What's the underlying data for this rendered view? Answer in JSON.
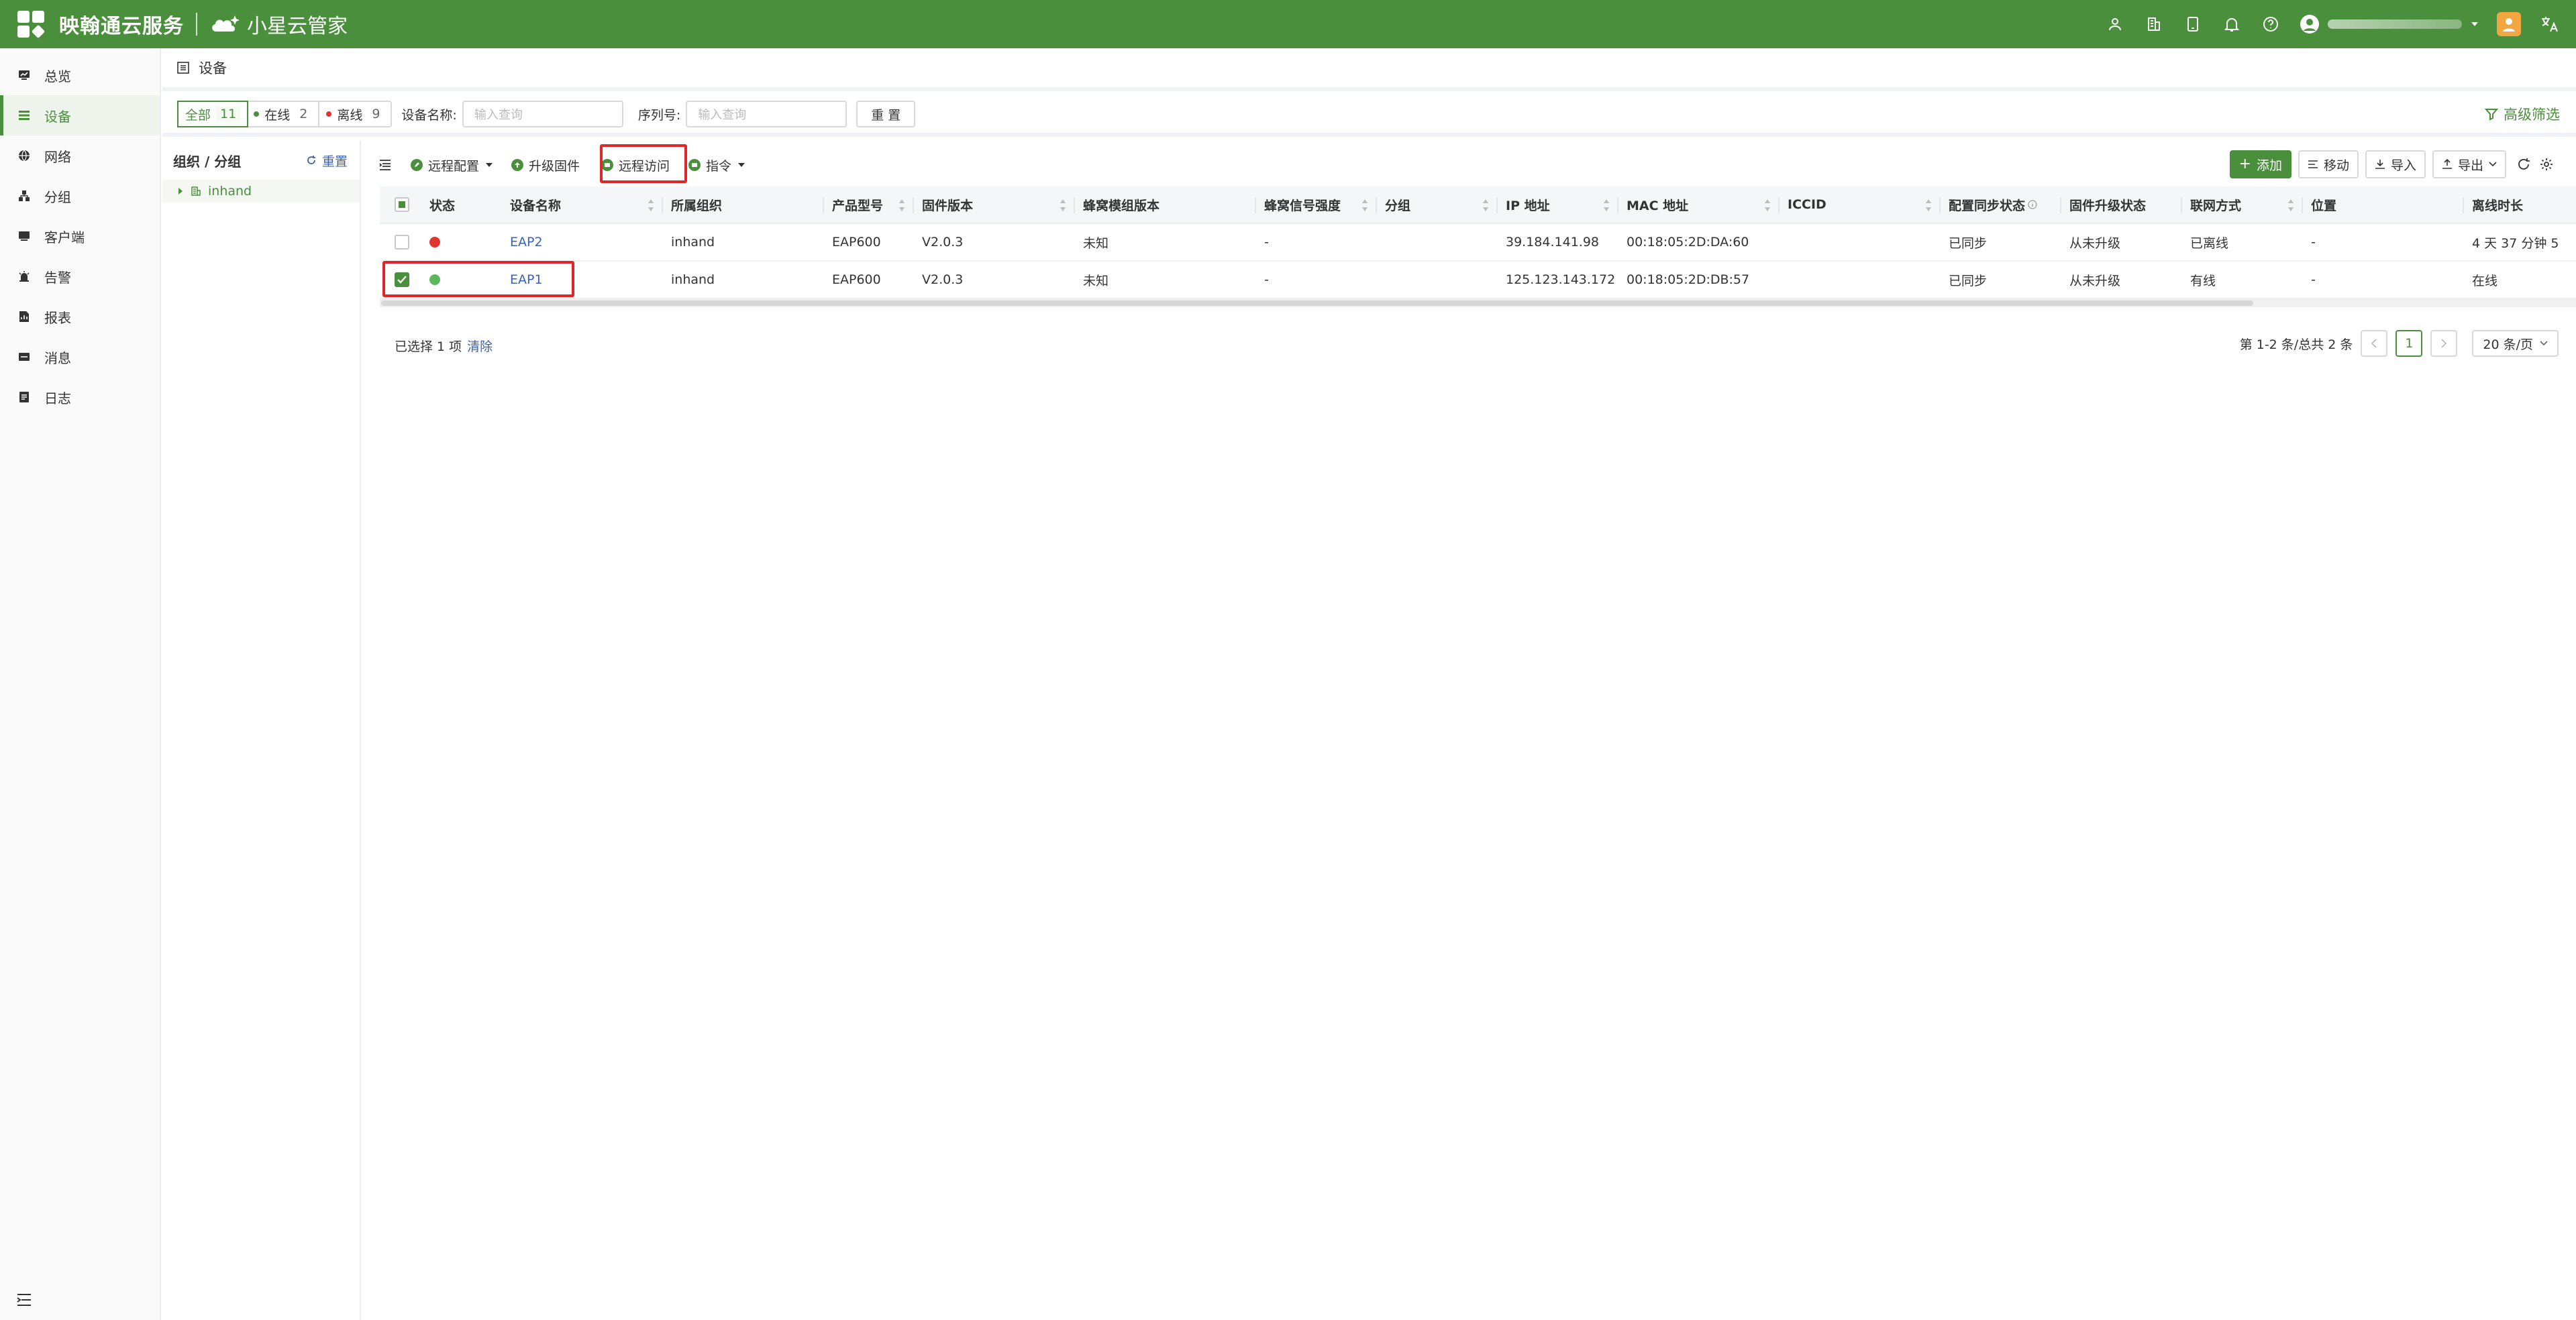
{
  "header": {
    "brand": "映翰通云服务",
    "product": "小星云管家"
  },
  "sidebar": {
    "items": [
      {
        "label": "总览",
        "icon": "dashboard-icon"
      },
      {
        "label": "设备",
        "icon": "device-list-icon",
        "active": true
      },
      {
        "label": "网络",
        "icon": "globe-icon"
      },
      {
        "label": "分组",
        "icon": "group-icon"
      },
      {
        "label": "客户端",
        "icon": "client-icon"
      },
      {
        "label": "告警",
        "icon": "alarm-icon"
      },
      {
        "label": "报表",
        "icon": "report-icon"
      },
      {
        "label": "消息",
        "icon": "message-icon"
      },
      {
        "label": "日志",
        "icon": "log-icon"
      }
    ]
  },
  "page": {
    "title": "设备"
  },
  "filter": {
    "tabs": [
      {
        "label": "全部",
        "count": "11"
      },
      {
        "label": "在线",
        "count": "2"
      },
      {
        "label": "离线",
        "count": "9"
      }
    ],
    "name_label": "设备名称:",
    "name_placeholder": "输入查询",
    "sn_label": "序列号:",
    "sn_placeholder": "输入查询",
    "reset_label": "重 置",
    "advanced_label": "高级筛选"
  },
  "org": {
    "title": "组织 / 分组",
    "reset_label": "重置",
    "node": "inhand"
  },
  "toolbar": {
    "remote_config": "远程配置",
    "upgrade": "升级固件",
    "remote_access": "远程访问",
    "command": "指令",
    "add": "添加",
    "move": "移动",
    "import": "导入",
    "export": "导出"
  },
  "table": {
    "columns": [
      "状态",
      "设备名称",
      "所属组织",
      "产品型号",
      "固件版本",
      "蜂窝模组版本",
      "蜂窝信号强度",
      "分组",
      "IP 地址",
      "MAC 地址",
      "ICCID",
      "配置同步状态",
      "固件升级状态",
      "联网方式",
      "位置",
      "离线时长"
    ],
    "rows": [
      {
        "status": "offline",
        "name": "EAP2",
        "org": "inhand",
        "model": "EAP600",
        "firmware": "V2.0.3",
        "modem": "未知",
        "signal": "-",
        "group": "",
        "ip": "39.184.141.98",
        "mac": "00:18:05:2D:DA:60",
        "iccid": "",
        "sync": "已同步",
        "upgrade": "从未升级",
        "net": "已离线",
        "location": "-",
        "offline": "4 天 37 分钟 5",
        "checked": false
      },
      {
        "status": "online",
        "name": "EAP1",
        "org": "inhand",
        "model": "EAP600",
        "firmware": "V2.0.3",
        "modem": "未知",
        "signal": "-",
        "group": "",
        "ip": "125.123.143.172",
        "mac": "00:18:05:2D:DB:57",
        "iccid": "",
        "sync": "已同步",
        "upgrade": "从未升级",
        "net": "有线",
        "location": "-",
        "offline": "在线",
        "checked": true
      }
    ]
  },
  "footer": {
    "selected_text": "已选择 1 项",
    "clear_label": "清除",
    "range_text": "第 1-2 条/总共 2 条",
    "current_page": "1",
    "page_size": "20 条/页"
  },
  "colors": {
    "brand": "#4a8f3c",
    "link": "#3a62b8",
    "online": "#5cb85c",
    "offline": "#e0342c",
    "highlight": "#e0262b"
  }
}
